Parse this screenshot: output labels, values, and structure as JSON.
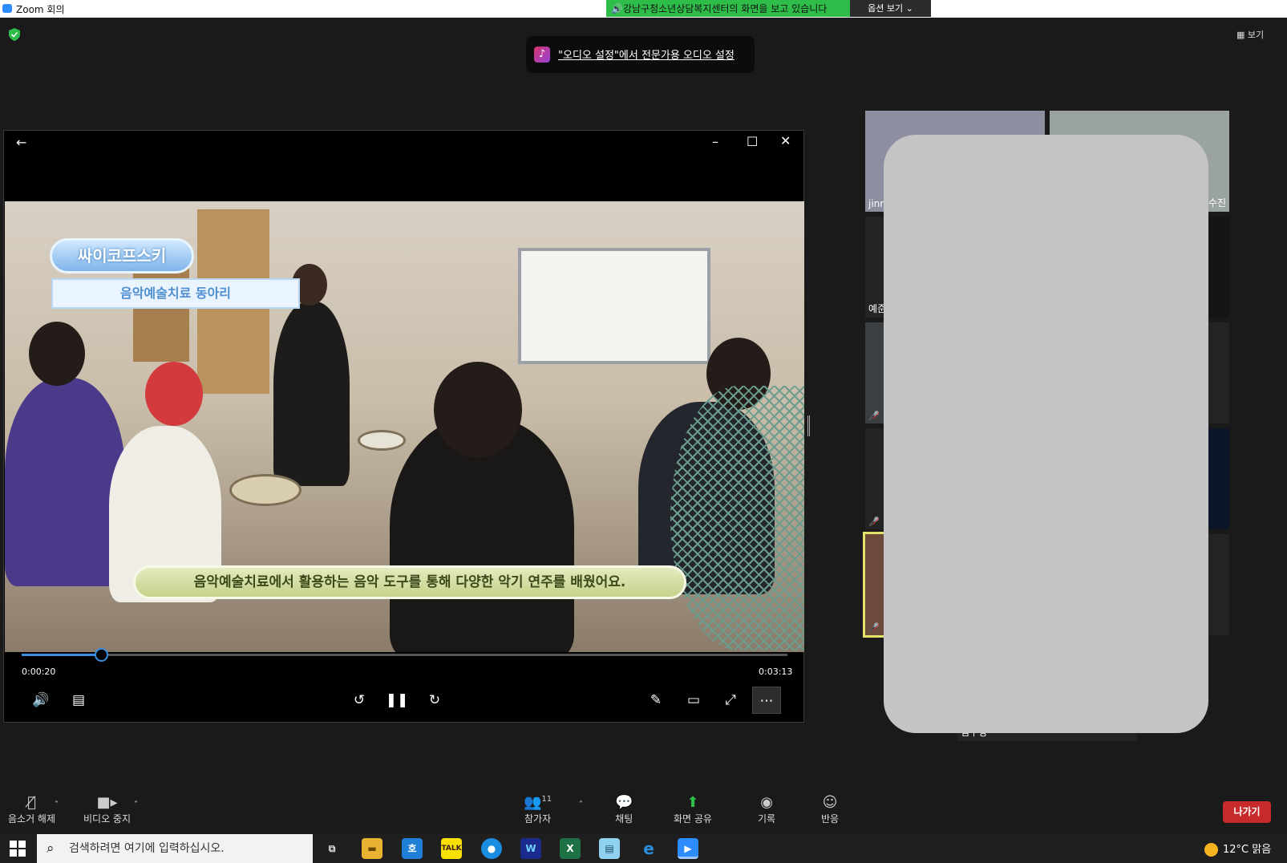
{
  "window": {
    "title": "Zoom 회의"
  },
  "share_banner": {
    "text": "강남구청소년상담복지센터의 화면을 보고 있습니다",
    "options_label": "옵션 보기"
  },
  "view_button": {
    "label": "보기"
  },
  "audio_toast": {
    "text": "\"오디오 설정\"에서 전문가용 오디오 설정"
  },
  "player": {
    "badge_title": "싸이코프스키",
    "badge_subtitle": "음악예술치료 동아리",
    "caption": "음악예술치료에서 활용하는 음악 도구를 통해 다양한 악기 연주를 배웠어요.",
    "current_time": "0:00:20",
    "total_time": "0:03:13",
    "progress": 0.104
  },
  "gallery": {
    "tiles": [
      {
        "name": "jinn"
      },
      {
        "name": "수진"
      },
      {
        "name": "예준"
      },
      {
        "name": ""
      },
      {
        "name": ""
      },
      {
        "name": ""
      },
      {
        "name": ""
      },
      {
        "name": ""
      },
      {
        "name": ""
      },
      {
        "name": ""
      }
    ],
    "bottom_name": "김수정"
  },
  "toolbar": {
    "mute_label": "음소거 해제",
    "video_label": "비디오 중지",
    "participants_label": "참가자",
    "participants_count": "11",
    "chat_label": "채팅",
    "share_label": "화면 공유",
    "record_label": "기록",
    "reactions_label": "반응",
    "leave_label": "나가기",
    "share_color": "#2fbd4a",
    "leave_color": "#c72a2a"
  },
  "taskbar": {
    "search_placeholder": "검색하려면 여기에 입력하십시오.",
    "weather": "12°C 맑음",
    "apps": [
      "task-view",
      "file-explorer",
      "hancom",
      "kakaotalk",
      "messenger",
      "webex",
      "excel",
      "notepad",
      "internet-explorer",
      "zoom"
    ]
  }
}
